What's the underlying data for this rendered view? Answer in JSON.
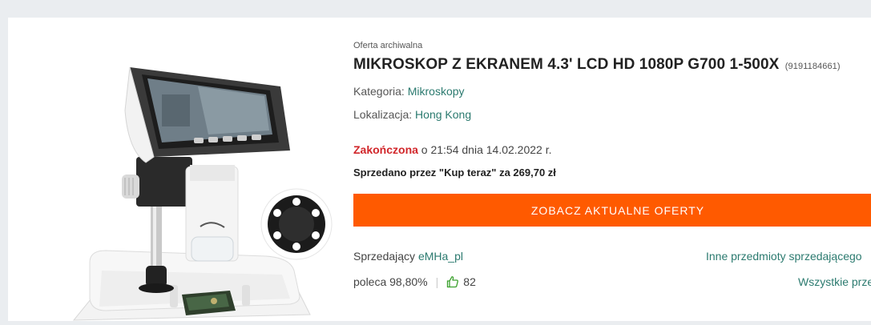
{
  "offer": {
    "archived_label": "Oferta archiwalna",
    "title": "MIKROSKOP Z EKRANEM 4.3' LCD HD 1080P G700 1-500X",
    "offer_id": "(9191184661)",
    "category_label": "Kategoria: ",
    "category_value": "Mikroskopy",
    "location_label": "Lokalizacja: ",
    "location_value": "Hong Kong",
    "status_ended": "Zakończona",
    "status_detail": " o 21:54 dnia 14.02.2022 r.",
    "sold_text": "Sprzedano przez \"Kup teraz\" za 269,70 zł",
    "cta_label": "ZOBACZ AKTUALNE OFERTY"
  },
  "seller": {
    "label": "Sprzedający ",
    "name": "eMHa_pl",
    "recommends_label": "poleca 98,80%",
    "separator": "|",
    "likes": "82",
    "other_items_link": "Inne przedmioty sprzedającego",
    "all_items_link": "Wszystkie przedmioty"
  },
  "colors": {
    "accent_orange": "#ff5a00",
    "link_teal": "#2b7a6f",
    "ended_red": "#d1262a",
    "like_green": "#3aa02c"
  },
  "icons": {
    "like": "thumbs-up-icon"
  }
}
